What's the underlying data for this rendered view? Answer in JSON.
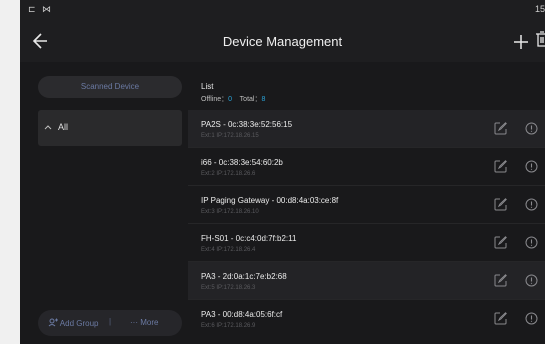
{
  "status_bar": {
    "left": "⊏ ⋈",
    "time": "15"
  },
  "header": {
    "title": "Device Management"
  },
  "sidebar": {
    "scanned_label": "Scanned Device",
    "group_label": "All",
    "add_group_label": "Add Group",
    "separator": "|",
    "more_label": "··· More"
  },
  "list": {
    "title": "List",
    "offline_label": "Offline：",
    "offline_count": "0",
    "total_label": "Total：",
    "total_count": "8",
    "devices": [
      {
        "name": "PA2S - 0c:38:3e:52:56:15",
        "meta": "Ext:1    IP:172.18.26.15"
      },
      {
        "name": "i66 - 0c:38:3e:54:60:2b",
        "meta": "Ext:2    IP:172.18.26.6"
      },
      {
        "name": "IP Paging Gateway - 00:d8:4a:03:ce:8f",
        "meta": "Ext:3    IP:172.18.26.10"
      },
      {
        "name": "FH-S01 - 0c:c4:0d:7f:b2:11",
        "meta": "Ext:4    IP:172.18.26.4"
      },
      {
        "name": "PA3 - 2d:0a:1c:7e:b2:68",
        "meta": "Ext:5    IP:172.18.26.3"
      },
      {
        "name": "PA3 - 00:d8:4a:05:6f:cf",
        "meta": "Ext:6    IP:172.18.26.9"
      }
    ]
  },
  "icons": {
    "back": "arrow-left-icon",
    "add": "plus-icon",
    "delete": "trash-icon",
    "edit": "edit-icon",
    "info": "info-icon",
    "chevron": "chevron-up-icon",
    "group": "group-icon"
  },
  "colors": {
    "accent": "#2aa3d8",
    "muted_blue": "#6b7aa3",
    "background": "#1e1e20"
  }
}
